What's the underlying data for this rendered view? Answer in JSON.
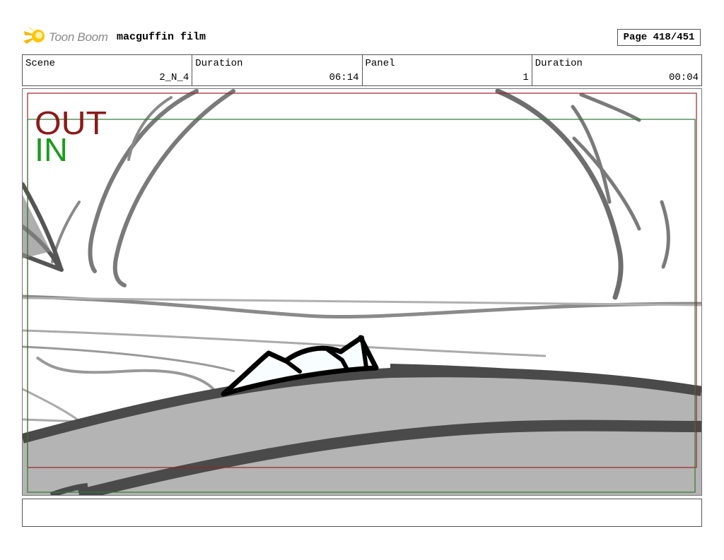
{
  "header": {
    "brand": "Toon Boom",
    "project": "macguffin film",
    "page": "Page 418/451"
  },
  "info": {
    "scene_label": "Scene",
    "scene_value": "2_N_4",
    "duration_label": "Duration",
    "duration_value": "06:14",
    "panel_label": "Panel",
    "panel_value": "1",
    "panel_duration_label": "Duration",
    "panel_duration_value": "00:04"
  },
  "panel": {
    "out_label": "OUT",
    "in_label": "IN",
    "out_color": "#8b1a1a",
    "in_color": "#1f9a1f"
  },
  "icons": {
    "logo": "toon-boom-logo-icon"
  }
}
